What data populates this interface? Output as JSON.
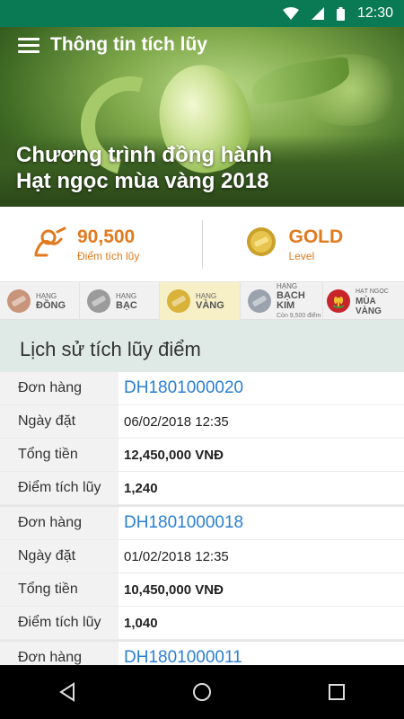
{
  "status_bar": {
    "time": "12:30",
    "icons": [
      "wifi-icon",
      "signal-icon",
      "battery-icon"
    ]
  },
  "header": {
    "title": "Thông tin tích lũy",
    "menu_icon": "hamburger-menu-icon"
  },
  "hero": {
    "campaign_line1": "Chương trình  đồng hành",
    "campaign_line2": "Hạt ngọc mùa vàng 2018"
  },
  "summary": {
    "points_value": "90,500",
    "points_label": "Điểm tích lũy",
    "level_value": "GOLD",
    "level_label": "Level",
    "accent_color": "#e07a1f"
  },
  "tiers": [
    {
      "line1": "HẠNG",
      "line2": "ĐỒNG",
      "line3": "",
      "color": "#c9957a",
      "active": false
    },
    {
      "line1": "HẠNG",
      "line2": "BẠC",
      "line3": "",
      "color": "#9b9b9b",
      "active": false
    },
    {
      "line1": "HẠNG",
      "line2": "VÀNG",
      "line3": "",
      "color": "#d9b23a",
      "active": true
    },
    {
      "line1": "HẠNG",
      "line2": "BẠCH KIM",
      "line3": "Còn 9,500 điểm",
      "color": "#9aa3ad",
      "active": false
    },
    {
      "line1": "HẠT NGỌC",
      "line2": "MÙA VÀNG",
      "line3": "",
      "color": "#c8242b",
      "active": false
    }
  ],
  "history": {
    "title": "Lịch sử tích lũy điểm",
    "labels": {
      "order": "Đơn hàng",
      "date": "Ngày đặt",
      "total": "Tổng tiền",
      "points": "Điểm tích lũy"
    },
    "entries": [
      {
        "order": "DH1801000020",
        "date": "06/02/2018 12:35",
        "total": "12,450,000 VNĐ",
        "points": "1,240"
      },
      {
        "order": "DH1801000018",
        "date": "01/02/2018 12:35",
        "total": "10,450,000 VNĐ",
        "points": "1,040"
      },
      {
        "order": "DH1801000011"
      }
    ]
  },
  "nav": {
    "back": "back-icon",
    "home": "home-icon",
    "recents": "recents-icon"
  }
}
